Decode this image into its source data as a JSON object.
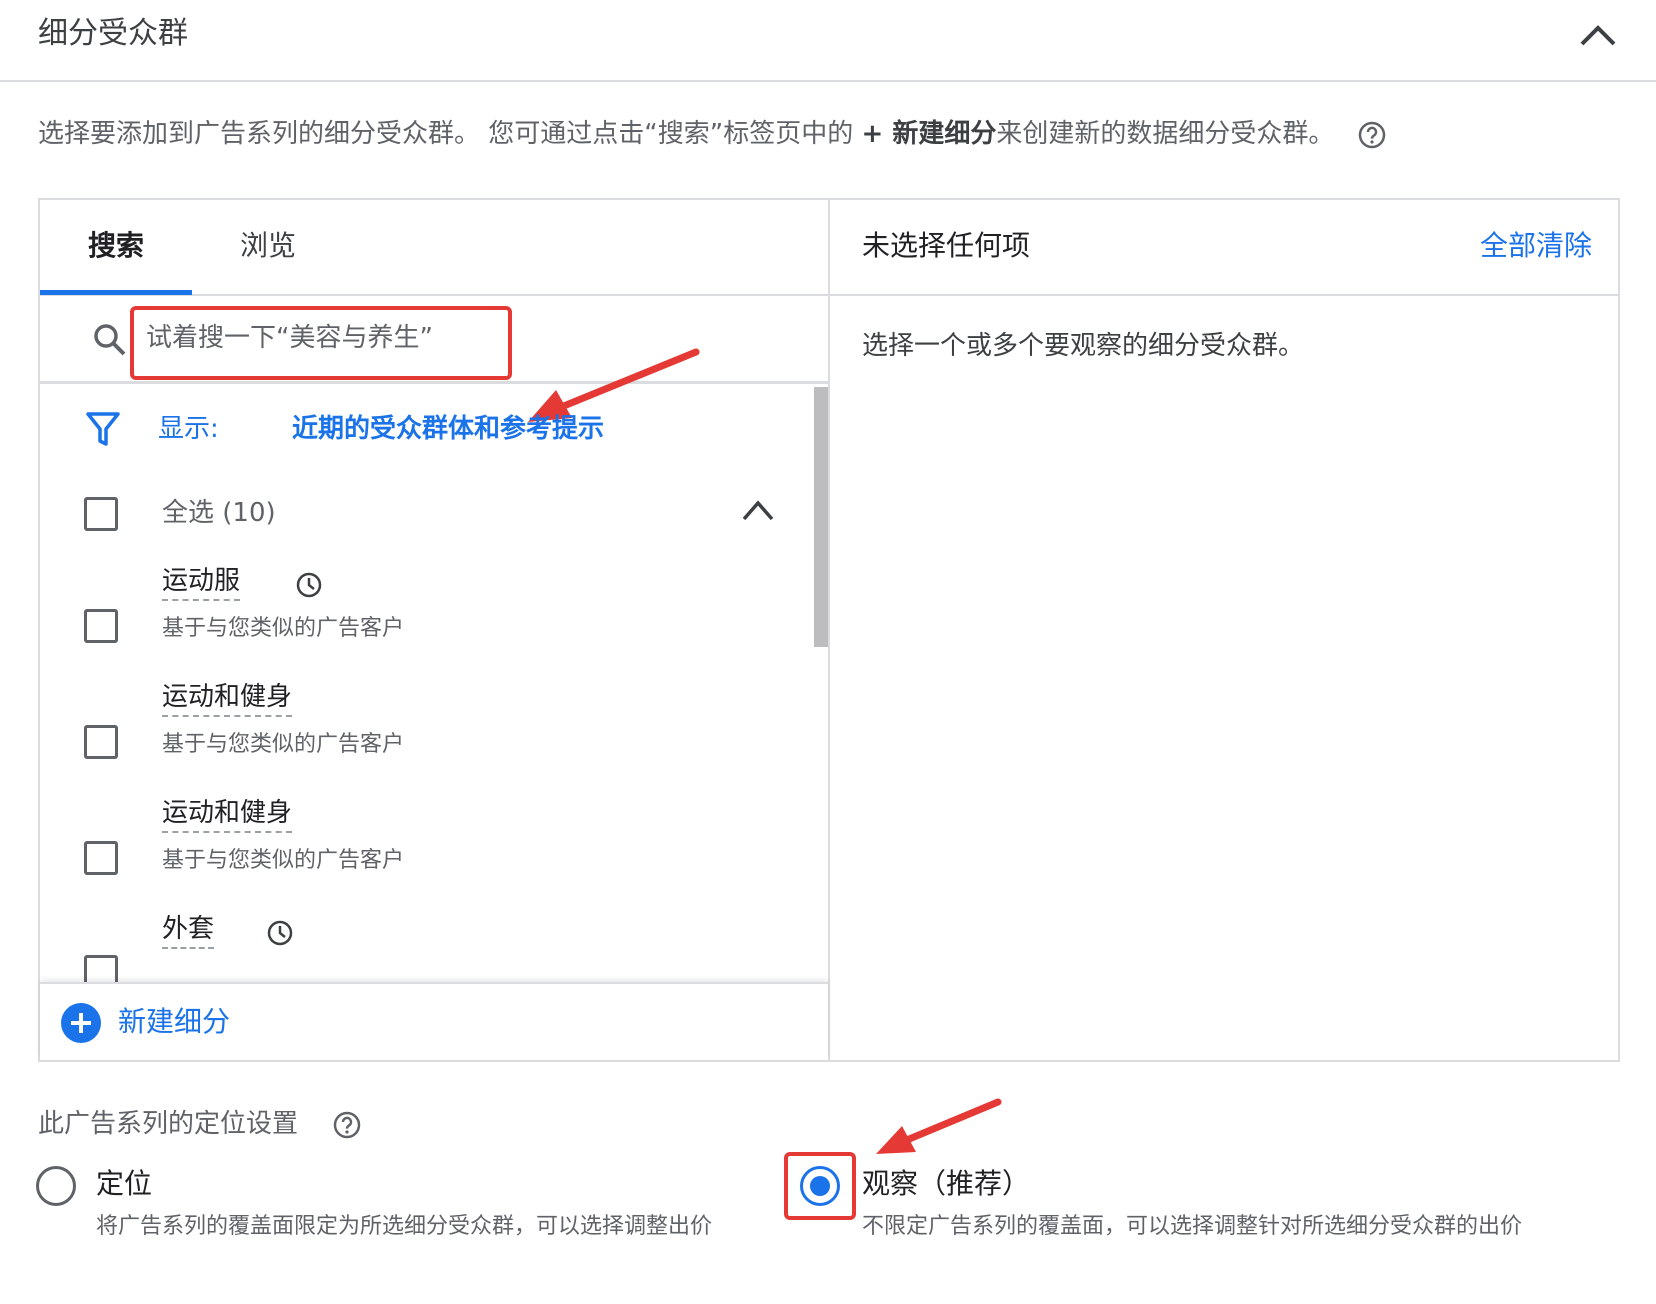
{
  "header": {
    "title": "细分受众群",
    "collapse_icon": "chevron-up-icon"
  },
  "intro": {
    "before": "选择要添加到广告系列的细分受众群。 您可通过点击“搜索”标签页中的 ",
    "bold": "+ 新建细分",
    "after": "来创建新的数据细分受众群。",
    "help_icon": "help-circle-icon"
  },
  "tabs": [
    {
      "label": "搜索",
      "active": true
    },
    {
      "label": "浏览",
      "active": false
    }
  ],
  "search": {
    "placeholder": "试着搜一下“美容与养生”",
    "icon": "search-icon"
  },
  "filter": {
    "label": "显示:",
    "value": "近期的受众群体和参考提示",
    "icon": "filter-icon"
  },
  "select_all": {
    "label": "全选 (10)"
  },
  "items": [
    {
      "title": "运动服",
      "subtitle": "基于与您类似的广告客户",
      "recent": true
    },
    {
      "title": "运动和健身",
      "subtitle": "基于与您类似的广告客户",
      "recent": false
    },
    {
      "title": "运动和健身",
      "subtitle": "基于与您类似的广告客户",
      "recent": false
    },
    {
      "title": "外套",
      "subtitle": "",
      "recent": true
    }
  ],
  "new_segment": {
    "label": "新建细分",
    "icon": "plus-circle-icon"
  },
  "selected_panel": {
    "title": "未选择任何项",
    "clear_all": "全部清除",
    "empty_text": "选择一个或多个要观察的细分受众群。"
  },
  "targeting": {
    "title": "此广告系列的定位设置",
    "options": [
      {
        "title": "定位",
        "desc": "将广告系列的覆盖面限定为所选细分受众群，可以选择调整出价",
        "checked": false
      },
      {
        "title": "观察（推荐）",
        "desc": "不限定广告系列的覆盖面，可以选择调整针对所选细分受众群的出价",
        "checked": true
      }
    ]
  },
  "colors": {
    "accent": "#1a73e8",
    "annotation": "#e53935",
    "text": "#3c4043",
    "border": "#dadce0"
  }
}
